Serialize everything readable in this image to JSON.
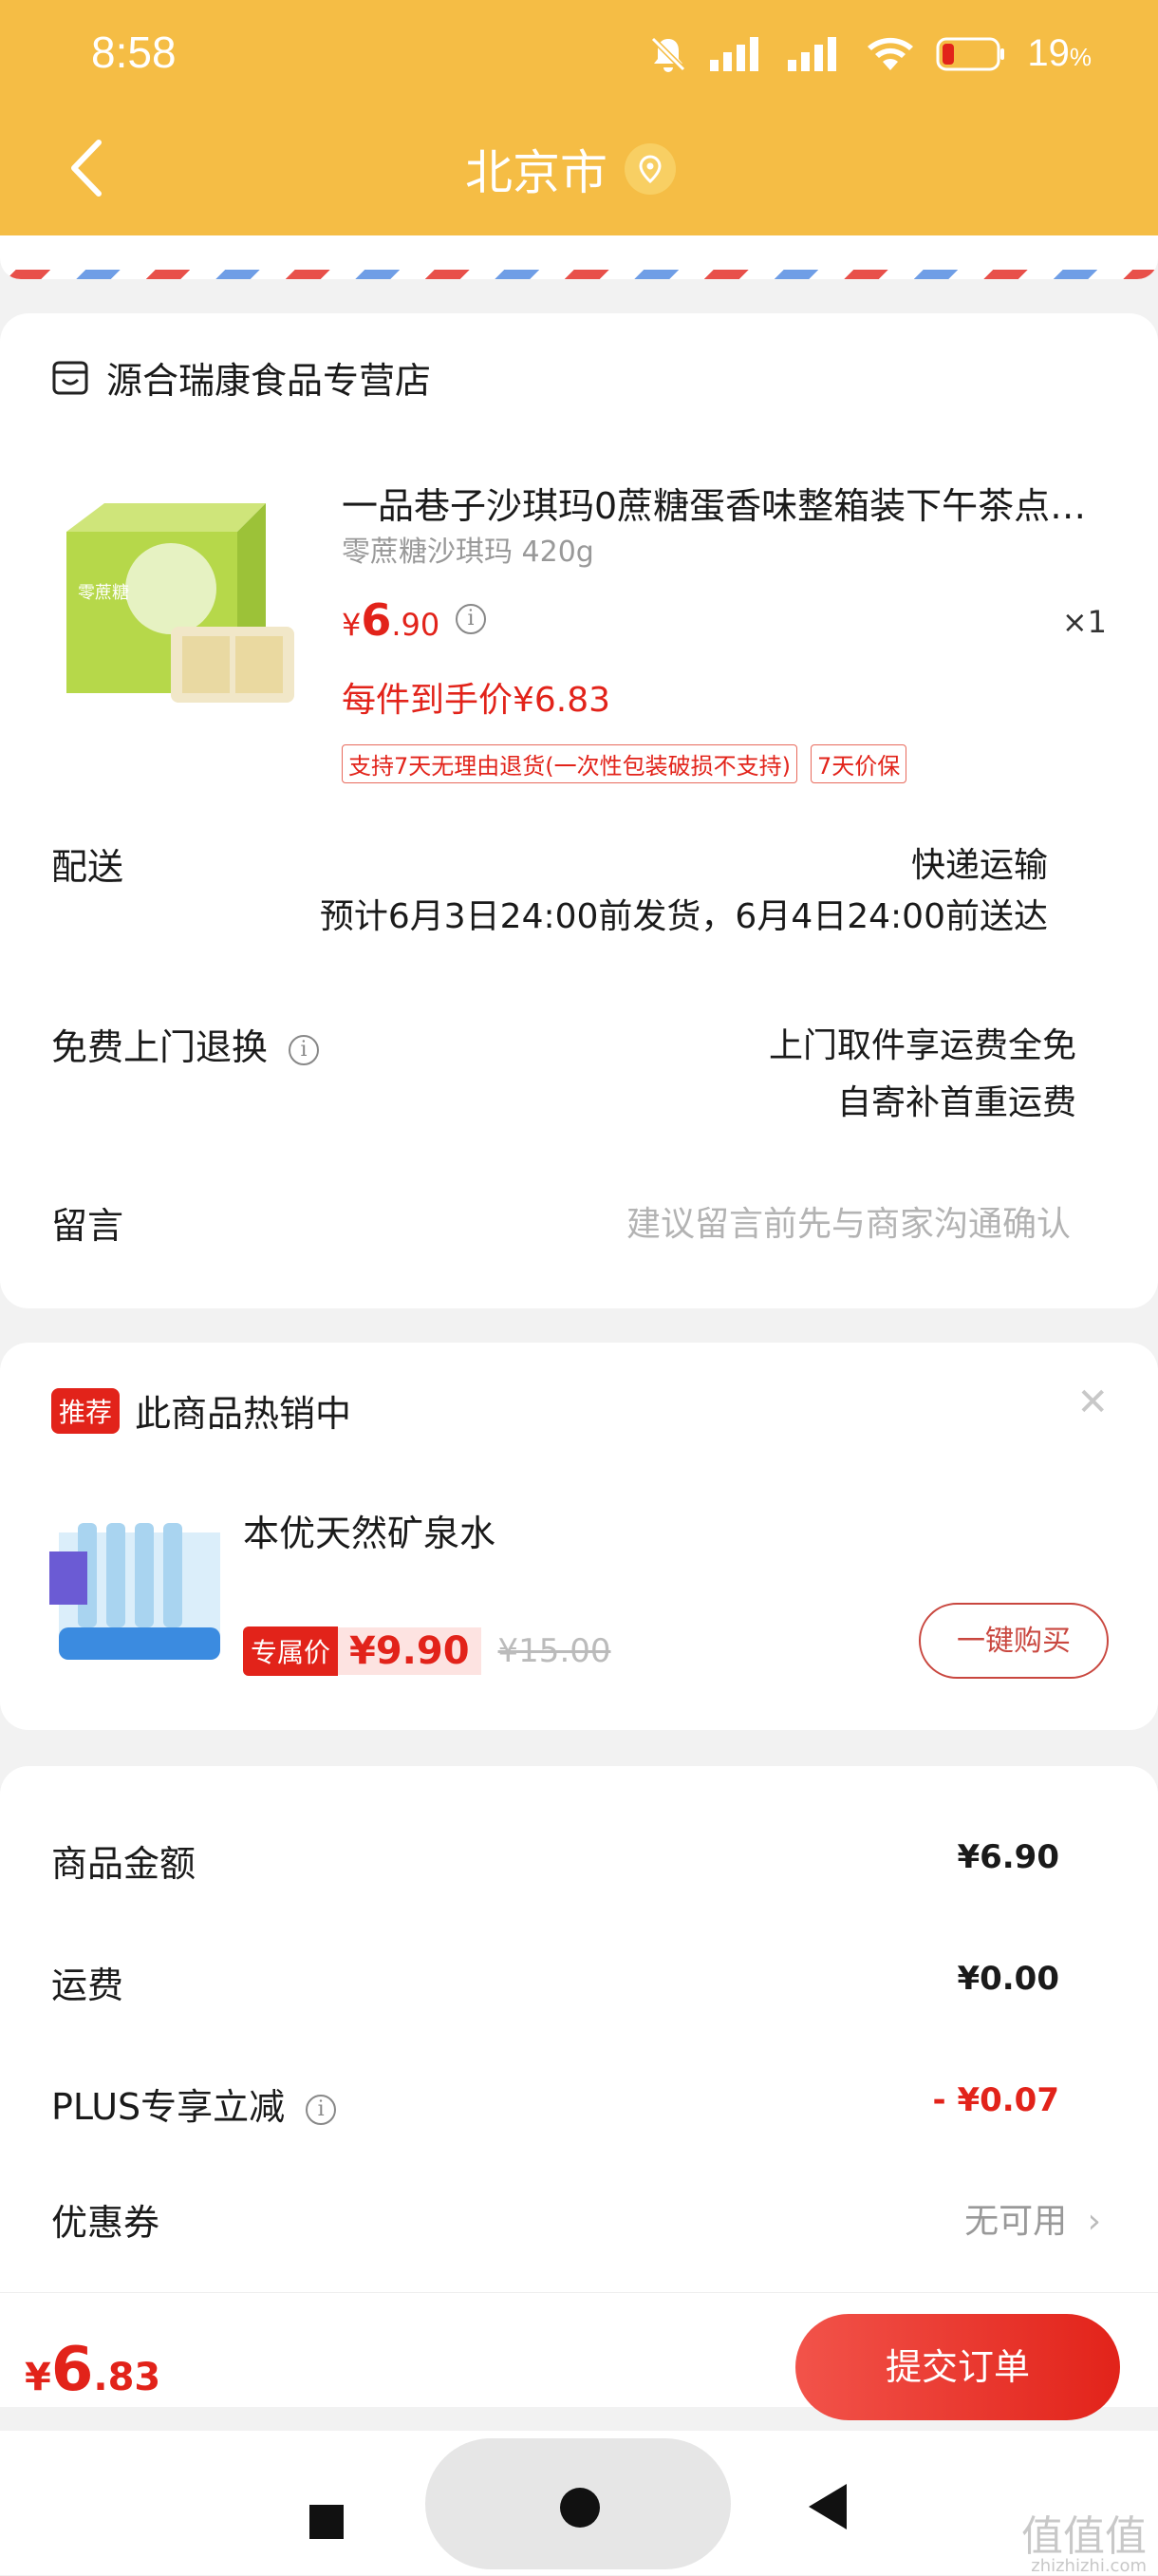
{
  "status": {
    "time": "8:58",
    "battery": "19",
    "battery_unit": "%"
  },
  "nav": {
    "title": "北京市"
  },
  "order": {
    "store_name": "源合瑞康食品专营店",
    "product": {
      "title": "一品巷子沙琪玛0蔗糖蛋香味整箱装下午茶点…",
      "spec": "零蔗糖沙琪玛 420g",
      "price_currency": "¥",
      "price_int": "6",
      "price_dec": ".90",
      "quantity": "×1",
      "unit_price": "每件到手价¥6.83",
      "tags": [
        "支持7天无理由退货(一次性包装破损不支持)",
        "7天价保"
      ]
    },
    "delivery": {
      "label": "配送",
      "method": "快递运输",
      "estimate": "预计6月3日24:00前发货，6月4日24:00前送达"
    },
    "return": {
      "label": "免费上门退换",
      "line1": "上门取件享运费全免",
      "line2": "自寄补首重运费"
    },
    "message": {
      "label": "留言",
      "placeholder": "建议留言前先与商家沟通确认"
    }
  },
  "recommend": {
    "tag": "推荐",
    "title": "此商品热销中",
    "item_name": "本优天然矿泉水",
    "promo_tag": "专属价",
    "promo_price": "¥9.90",
    "old_price": "¥15.00",
    "buy_label": "一键购买"
  },
  "summary": {
    "goods_label": "商品金额",
    "goods_value": "¥6.90",
    "shipping_label": "运费",
    "shipping_value": "¥0.00",
    "plus_label": "PLUS专享立减",
    "plus_value": "- ¥0.07",
    "coupon_label": "优惠券",
    "coupon_value": "无可用"
  },
  "footer": {
    "total_currency": "¥",
    "total_int": "6",
    "total_dec": ".83",
    "submit_label": "提交订单"
  },
  "watermark": {
    "line1": "值值值",
    "line2": "zhizhizhi.com"
  },
  "colors": {
    "header": "#f5bd45",
    "accent": "#e2231a"
  }
}
